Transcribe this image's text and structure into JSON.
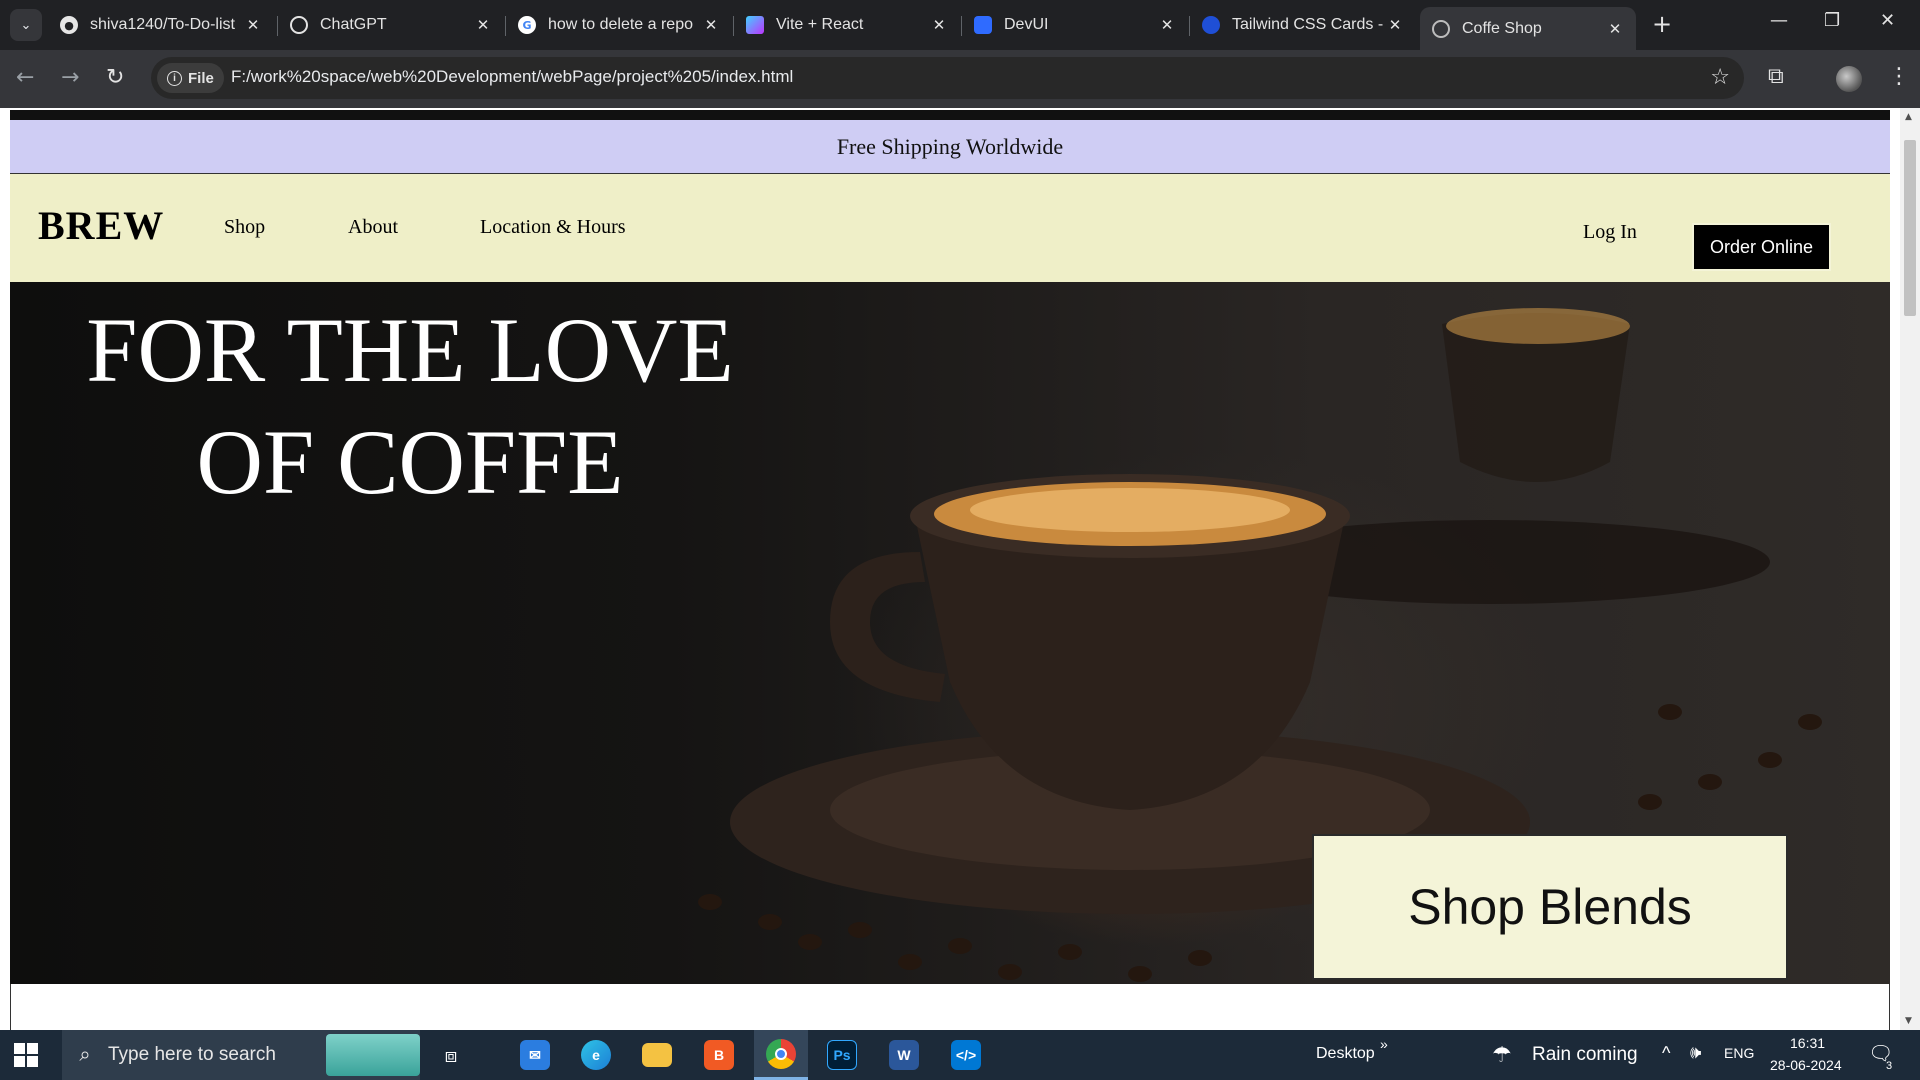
{
  "browser": {
    "tabs": [
      {
        "title": "shiva1240/To-Do-list",
        "icon": "github-icon",
        "active": false
      },
      {
        "title": "ChatGPT",
        "icon": "chatgpt-icon",
        "active": false
      },
      {
        "title": "how to delete a repo",
        "icon": "google-icon",
        "active": false
      },
      {
        "title": "Vite + React",
        "icon": "vite-icon",
        "active": false
      },
      {
        "title": "DevUI",
        "icon": "devui-icon",
        "active": false
      },
      {
        "title": "Tailwind CSS Cards -",
        "icon": "tailwind-icon",
        "active": false
      },
      {
        "title": "Coffe Shop",
        "icon": "globe-icon",
        "active": true
      }
    ],
    "close_glyph": "✕",
    "new_tab_glyph": "+",
    "address": {
      "chip_label": "File",
      "url": "F:/work%20space/web%20Development/webPage/project%205/index.html"
    }
  },
  "page": {
    "banner": "Free Shipping Worldwide",
    "brand": "BREW",
    "nav_links": [
      "Shop",
      "About",
      "Location & Hours"
    ],
    "login": "Log In",
    "order_button": "Order Online",
    "hero_line1": "FOR THE LOVE",
    "hero_line2": "OF COFFE",
    "shop_button": "Shop Blends"
  },
  "taskbar": {
    "search_placeholder": "Type here to search",
    "desktop_label": "Desktop",
    "weather": "Rain coming",
    "language": "ENG",
    "time": "16:31",
    "date": "28-06-2024",
    "notification_count": "3",
    "apps": [
      "mail-icon",
      "edge-icon",
      "file-explorer-icon",
      "brave-icon",
      "chrome-icon",
      "photoshop-icon",
      "word-icon",
      "vscode-icon"
    ]
  },
  "colors": {
    "banner_bg": "#cfcdf4",
    "nav_bg": "#efefc8",
    "order_bg": "#000000",
    "shop_bg": "#f4f4d8"
  }
}
